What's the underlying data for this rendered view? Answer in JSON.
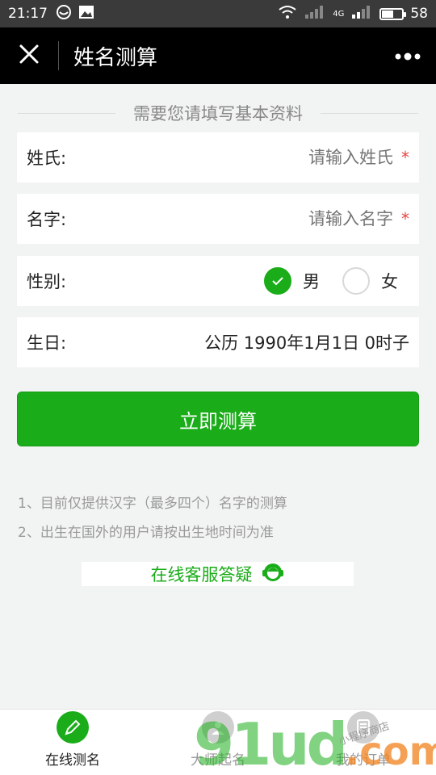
{
  "status_bar": {
    "time": "21:17",
    "battery": "58",
    "battery_level": 0.58,
    "network": "4G",
    "icons": [
      "wechat-icon",
      "image-icon",
      "wifi-icon",
      "signal-icon",
      "battery-icon"
    ]
  },
  "header": {
    "title": "姓名测算",
    "close_icon": "close-icon",
    "more_icon": "more-icon"
  },
  "form": {
    "section_title": "需要您请填写基本资料",
    "surname": {
      "label": "姓氏:",
      "placeholder": "请输入姓氏",
      "required_mark": "*"
    },
    "given_name": {
      "label": "名字:",
      "placeholder": "请输入名字",
      "required_mark": "*"
    },
    "gender": {
      "label": "性别:",
      "options": [
        "男",
        "女"
      ],
      "selected": "男"
    },
    "birthday": {
      "label": "生日:",
      "value": "公历 1990年1月1日 0时子"
    },
    "submit_label": "立即测算"
  },
  "notes": [
    "1、目前仅提供汉字（最多四个）名字的测算",
    "2、出生在国外的用户请按出生地时间为准"
  ],
  "service": {
    "label": "在线客服答疑",
    "icon": "customer-service-icon"
  },
  "tabs": [
    {
      "label": "在线测名",
      "icon": "pencil-icon",
      "active": true
    },
    {
      "label": "大师起名",
      "icon": "master-icon",
      "active": false
    },
    {
      "label": "我的订单",
      "icon": "order-icon",
      "active": false
    }
  ],
  "watermark": {
    "text": "91ud",
    "suffix": ".com",
    "small": "小程序商店"
  },
  "colors": {
    "accent": "#1aad19",
    "required": "#e64340",
    "header_bg": "#000000",
    "background": "#f2f4f3"
  }
}
